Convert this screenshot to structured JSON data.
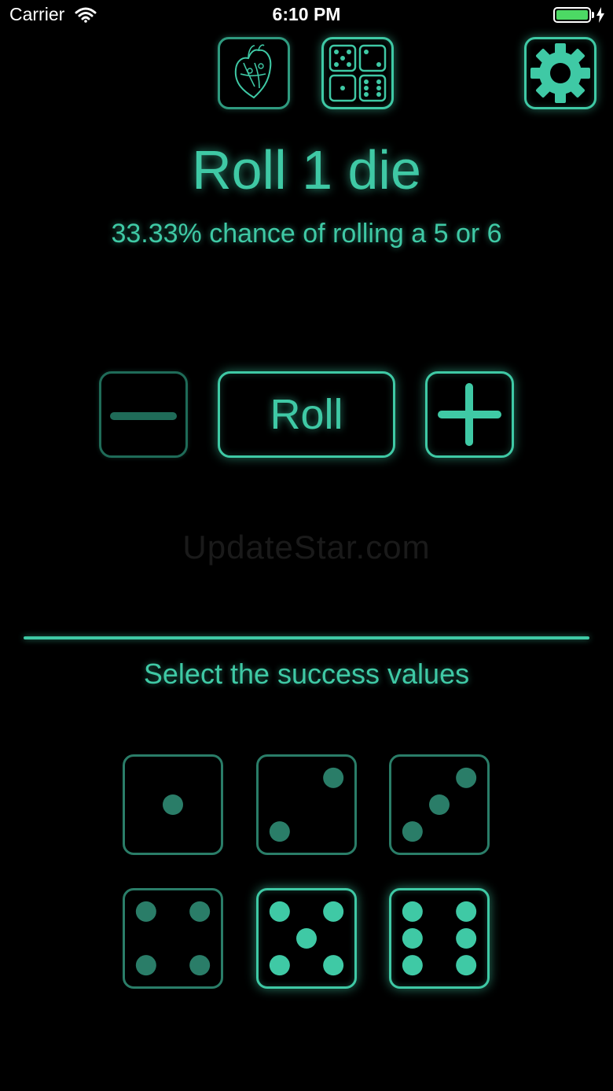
{
  "status_bar": {
    "carrier": "Carrier",
    "time": "6:10 PM",
    "battery_level": 1.0
  },
  "toolbar": {
    "history_icon": "heart-icon",
    "dice_mode_icon": "dice-icon",
    "settings_icon": "gear-icon"
  },
  "header": {
    "title": "Roll 1 die",
    "subtitle": "33.33% chance of rolling a 5 or 6"
  },
  "controls": {
    "decrease_icon": "minus-icon",
    "roll_label": "Roll",
    "increase_icon": "plus-icon",
    "decrease_enabled": false
  },
  "watermark": "UpdateStar.com",
  "success_values": {
    "label": "Select the success values",
    "faces": [
      {
        "value": 1,
        "selected": false
      },
      {
        "value": 2,
        "selected": false
      },
      {
        "value": 3,
        "selected": false
      },
      {
        "value": 4,
        "selected": false
      },
      {
        "value": 5,
        "selected": true
      },
      {
        "value": 6,
        "selected": true
      }
    ]
  },
  "colors": {
    "accent": "#3fc9a5",
    "accent_dim": "#2a7d68",
    "background": "#000000",
    "battery": "#4cd964"
  }
}
